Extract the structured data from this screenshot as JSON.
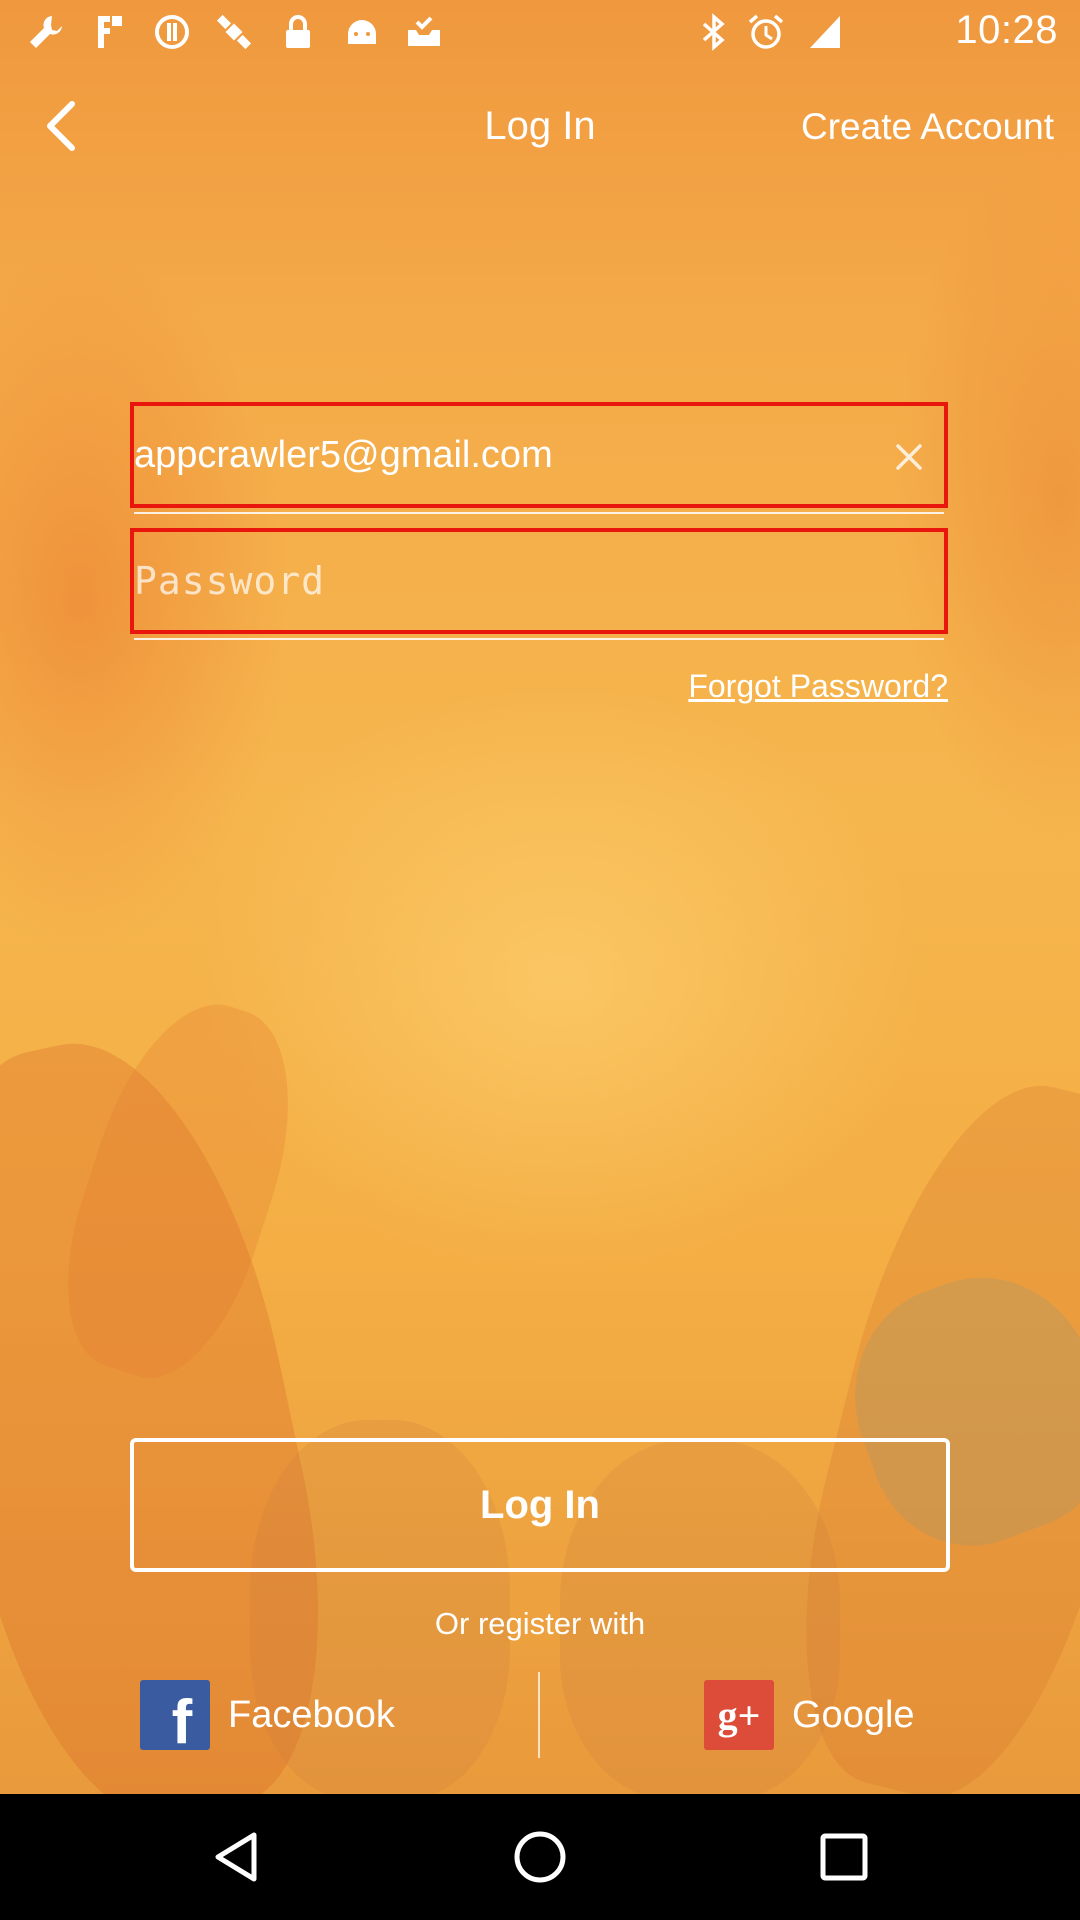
{
  "status_bar": {
    "time": "10:28",
    "left_icons": [
      "wrench-icon",
      "facebook-lite-icon",
      "data-saver-icon",
      "satellite-icon",
      "lock-icon",
      "android-icon",
      "inbox-check-icon"
    ],
    "right_icons": [
      "bluetooth-icon",
      "alarm-icon",
      "signal-icon"
    ]
  },
  "header": {
    "title": "Log In",
    "create_account": "Create Account"
  },
  "form": {
    "email_value": "appcrawler5@gmail.com",
    "password_placeholder": "Password",
    "forgot_password": "Forgot Password?",
    "login_label": "Log In",
    "highlight_color": "#e8160c"
  },
  "social": {
    "or_register": "Or register with",
    "facebook_label": "Facebook",
    "facebook_glyph": "f",
    "facebook_color": "#3b5ba0",
    "google_label": "Google",
    "google_glyph": "g+",
    "google_color": "#dd4b39"
  },
  "nav_bar": {
    "buttons": [
      "back-triangle-icon",
      "home-circle-icon",
      "recents-square-icon"
    ]
  }
}
